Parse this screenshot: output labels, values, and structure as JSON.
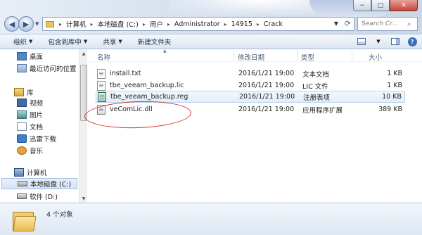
{
  "window": {
    "controls": {
      "min": "−",
      "max": "□",
      "close": "✕"
    }
  },
  "nav": {
    "back_icon": "back-arrow-icon",
    "forward_icon": "forward-arrow-icon",
    "breadcrumb": [
      "计算机",
      "本地磁盘 (C:)",
      "用户",
      "Administrator",
      "14915",
      "Crack"
    ],
    "search_placeholder": "Search Cr..."
  },
  "toolbar": {
    "organize": "组织",
    "include_in_library": "包含到库中",
    "share": "共享",
    "new_folder": "新建文件夹"
  },
  "sidebar": {
    "items": [
      {
        "label": "桌面",
        "icon": "desktop-icon"
      },
      {
        "label": "最近访问的位置",
        "icon": "recent-places-icon"
      },
      {
        "label": "库",
        "icon": "library-icon"
      },
      {
        "label": "视频",
        "icon": "video-icon"
      },
      {
        "label": "图片",
        "icon": "pictures-icon"
      },
      {
        "label": "文档",
        "icon": "documents-icon"
      },
      {
        "label": "迅雷下载",
        "icon": "thunder-icon"
      },
      {
        "label": "音乐",
        "icon": "music-icon"
      },
      {
        "label": "计算机",
        "icon": "computer-icon"
      },
      {
        "label": "本地磁盘 (C:)",
        "icon": "drive-icon"
      },
      {
        "label": "软件 (D:)",
        "icon": "drive-icon"
      }
    ]
  },
  "columns": {
    "name": "名称",
    "date": "修改日期",
    "type": "类型",
    "size": "大小"
  },
  "files": [
    {
      "name": "install.txt",
      "date": "2016/1/21 19:00",
      "type": "文本文档",
      "size": "1 KB",
      "icon": "text-file-icon"
    },
    {
      "name": "tbe_veeam_backup.lic",
      "date": "2016/1/21 19:00",
      "type": "LIC 文件",
      "size": "1 KB",
      "icon": "file-icon"
    },
    {
      "name": "tbe_veeam_backup.reg",
      "date": "2016/1/21 19:00",
      "type": "注册表项",
      "size": "10 KB",
      "icon": "registry-file-icon"
    },
    {
      "name": "veComLic.dll",
      "date": "2016/1/21 19:00",
      "type": "应用程序扩展",
      "size": "389 KB",
      "icon": "dll-file-icon"
    }
  ],
  "status": {
    "count": "4 个对象"
  },
  "colors": {
    "highlight_circle": "#d0332f",
    "selection": "#e2edfb"
  }
}
